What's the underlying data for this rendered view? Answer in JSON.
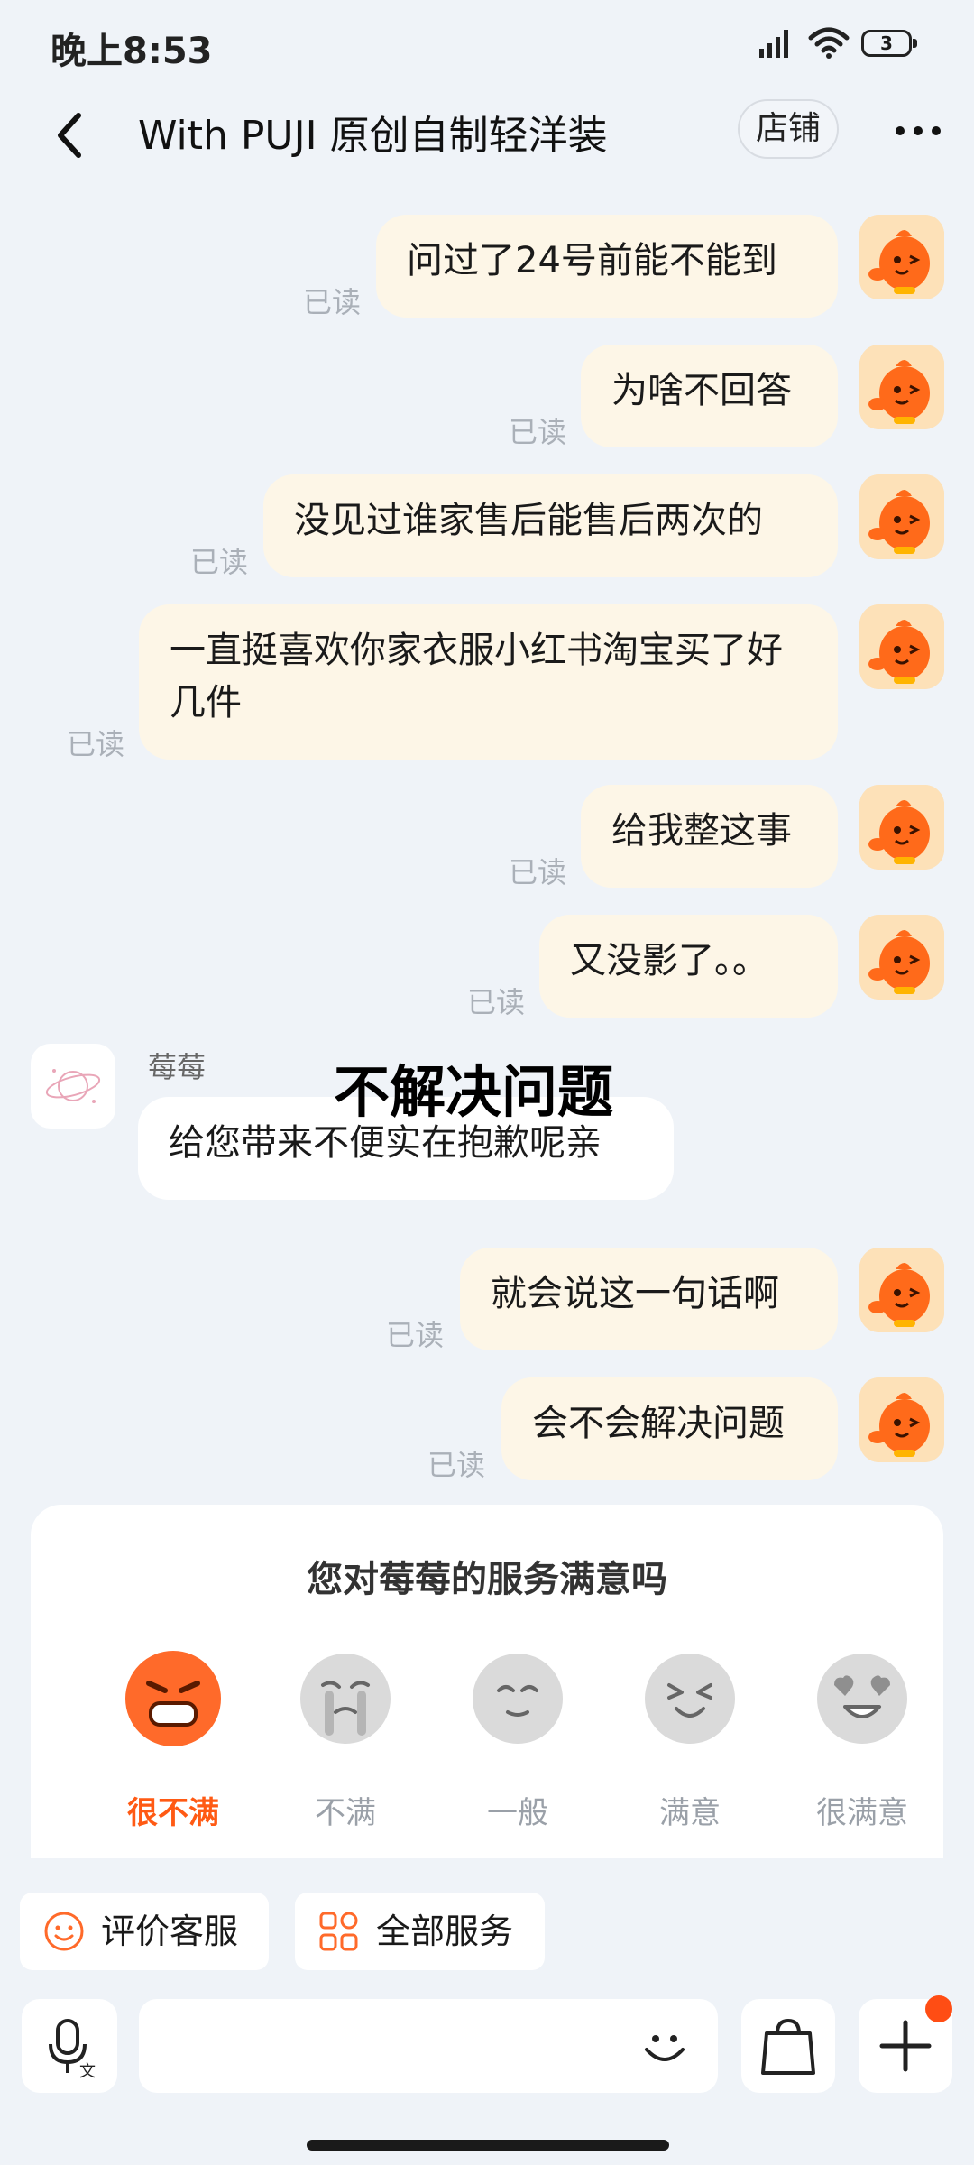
{
  "status_bar": {
    "time": "晚上8:53",
    "battery": "3"
  },
  "header": {
    "title": "With PUJI 原创自制轻洋装",
    "shop_label": "店铺"
  },
  "read_label": "已读",
  "messages": [
    {
      "text": "问过了24号前能不能到"
    },
    {
      "text": "为啥不回答"
    },
    {
      "text": "没见过谁家售后能售后两次的"
    },
    {
      "text": "一直挺喜欢你家衣服小红书淘宝买了好几件"
    },
    {
      "text": "给我整这事"
    },
    {
      "text": "又没影了。。"
    },
    {
      "text": "就会说这一句话啊"
    },
    {
      "text": "会不会解决问题"
    }
  ],
  "agent": {
    "name": "莓莓",
    "message": "给您带来不便实在抱歉呢亲"
  },
  "overlay_caption": "不解决问题",
  "rating": {
    "question": "您对莓莓的服务满意吗",
    "options": [
      {
        "label": "很不满",
        "selected": true
      },
      {
        "label": "不满"
      },
      {
        "label": "一般"
      },
      {
        "label": "满意"
      },
      {
        "label": "很满意"
      }
    ],
    "selected_color": "#ff5a14"
  },
  "quick_actions": {
    "rate_service": "评价客服",
    "all_services": "全部服务"
  },
  "colors": {
    "bubble_self": "#fdf6e7",
    "bubble_agent": "#ffffff",
    "background": "#eff3f8",
    "accent": "#ff5a14"
  }
}
